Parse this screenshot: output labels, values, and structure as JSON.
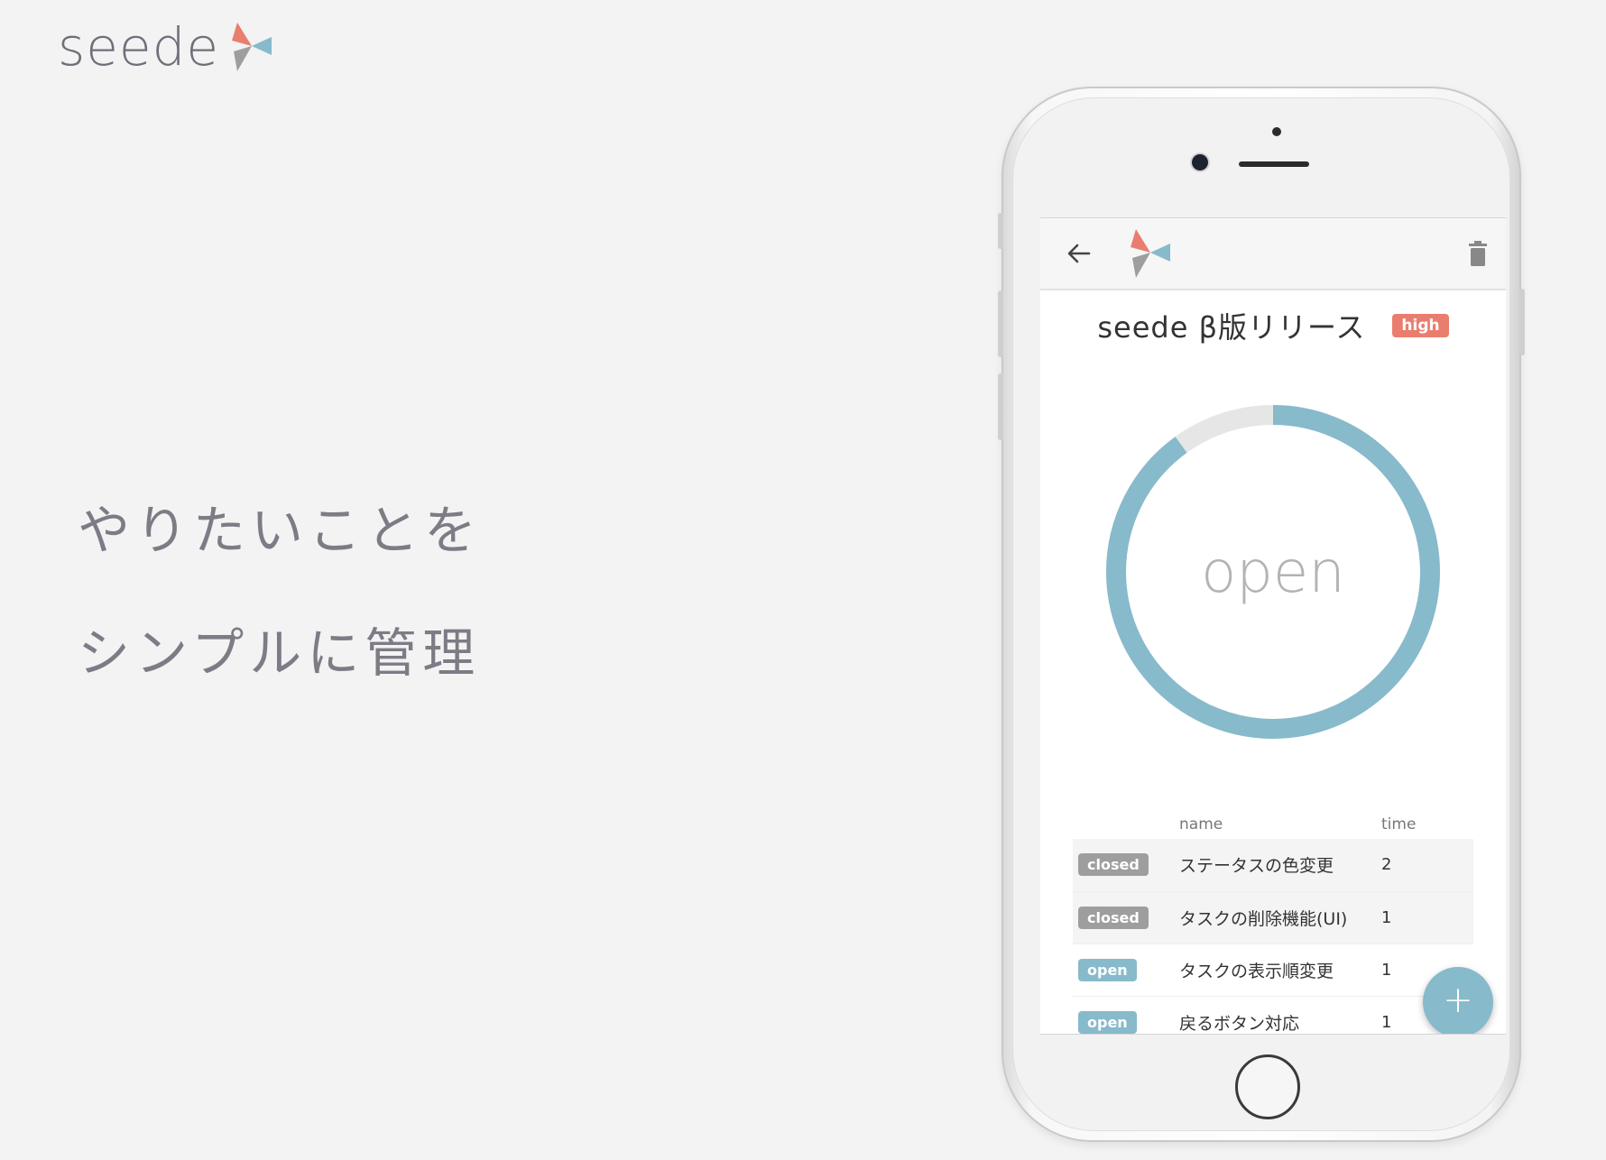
{
  "brand": {
    "name": "seede",
    "logo_icon": "seede-logo-icon"
  },
  "tagline": {
    "line1": "やりたいことを",
    "line2": "シンプルに管理"
  },
  "colors": {
    "accent": "#87bacb",
    "priority_high": "#ea7e6e",
    "closed": "#9e9e9e",
    "ring_track": "#e6e6e6"
  },
  "app": {
    "back_icon": "arrow-left-icon",
    "delete_icon": "trash-icon",
    "title": "seede β版リリース",
    "priority": "high",
    "progress": {
      "label": "open",
      "fraction": 0.9
    },
    "table": {
      "headers": {
        "name": "name",
        "time": "time"
      },
      "rows": [
        {
          "status": "closed",
          "name": "ステータスの色変更",
          "time": "2"
        },
        {
          "status": "closed",
          "name": "タスクの削除機能(UI)",
          "time": "1"
        },
        {
          "status": "open",
          "name": "タスクの表示順変更",
          "time": "1"
        },
        {
          "status": "open",
          "name": "戻るボタン対応",
          "time": "1"
        }
      ]
    },
    "add_label": "+"
  }
}
